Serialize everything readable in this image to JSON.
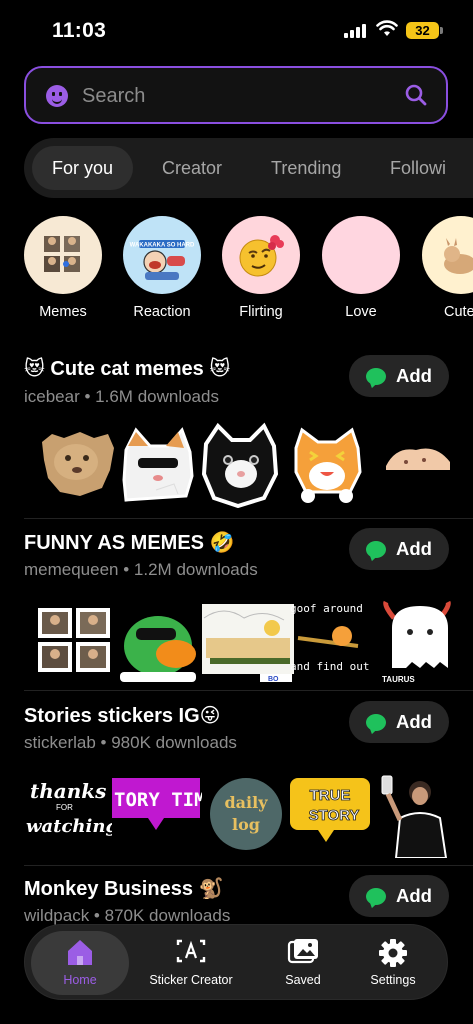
{
  "status_bar": {
    "time": "11:03",
    "battery": "32"
  },
  "search": {
    "placeholder": "Search"
  },
  "tabs": [
    "For you",
    "Creator",
    "Trending",
    "Followi"
  ],
  "categories": [
    {
      "label": "Memes"
    },
    {
      "label": "Reaction"
    },
    {
      "label": "Flirting"
    },
    {
      "label": "Love"
    },
    {
      "label": "Cute"
    }
  ],
  "sections": [
    {
      "title": "😻 Cute cat memes 😻",
      "author": "icebear",
      "downloads": "1.6M downloads",
      "add_label": "Add"
    },
    {
      "title": "FUNNY AS MEMES 🤣",
      "author": "memequeen",
      "downloads": "1.2M downloads",
      "add_label": "Add"
    },
    {
      "title": "Stories stickers IG😜",
      "author": "stickerlab",
      "downloads": "980K downloads",
      "add_label": "Add"
    },
    {
      "title": "Monkey Business 🐒",
      "author": "wildpack",
      "downloads": "870K downloads",
      "add_label": "Add"
    }
  ],
  "section_separator": " • ",
  "sticker_text": {
    "goof_line1": "goof around",
    "goof_line2": "and find out",
    "taurus": "TAURUS",
    "thanks": "thanks",
    "for": "FOR",
    "watching": "watching",
    "story_time": "TORY TIM",
    "daily": "daily",
    "log": "log",
    "true": "TRUE",
    "story": "STORY",
    "reaction_text": "WAKAKAKA SO HARD"
  },
  "nav": [
    {
      "label": "Home",
      "icon": "home-icon"
    },
    {
      "label": "Sticker Creator",
      "icon": "sticker-creator-icon"
    },
    {
      "label": "Saved",
      "icon": "saved-icon"
    },
    {
      "label": "Settings",
      "icon": "settings-icon"
    }
  ],
  "colors": {
    "accent": "#9b5de5",
    "add_icon": "#1fc15c",
    "battery": "#f5c518"
  }
}
